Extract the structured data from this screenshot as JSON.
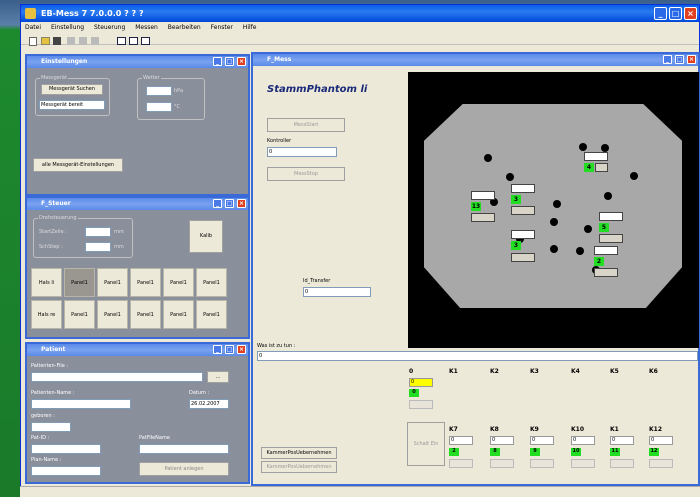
{
  "app": {
    "title": "EB-Mess 7   7.0.0.0 ? ? ?",
    "menu": [
      "Datei",
      "Einstellung",
      "Steuerung",
      "Messen",
      "Bearbeiten",
      "Fenster",
      "Hilfe"
    ]
  },
  "einstellungen": {
    "title": "Einstellungen",
    "messgeraet_group": "Messgerät",
    "suchen_btn": "Messgerät Suchen",
    "bereit_field": "Messgerät bereit",
    "wetter_group": "Wetter",
    "unit_hpa": "hPa",
    "unit_c": "°C",
    "alle_btn": "alle Messgerät-Einstellungen"
  },
  "steuer": {
    "title": "F_Steuer",
    "group": "Drehsteuerung",
    "startzeile_label": "StartZeile :",
    "startzeile_unit": "mm",
    "schritte_label": "SchStep :",
    "schritte_unit": "mm",
    "kalib_btn": "Kalib",
    "buttons_row1": [
      "Hals li",
      "Panel1",
      "Panel1",
      "Panel1",
      "Panel1",
      "Panel1"
    ],
    "buttons_row2": [
      "Hals re",
      "Panel1",
      "Panel1",
      "Panel1",
      "Panel1",
      "Panel1"
    ]
  },
  "patient": {
    "title": "Patient",
    "file_label": "Patienten-File :",
    "browse_btn": "...",
    "name_label": "Patienten-Name :",
    "datum_label": "Datum :",
    "datum_value": "26.02.2007",
    "geboren_label": "geboren :",
    "pat_id_label": "Pat-ID :",
    "patfilename_label": "PatFileName",
    "plan_label": "Plan-Name :",
    "bottom_btn": "Patient anlegen"
  },
  "mess": {
    "title": "F_Mess",
    "phantom_title": "StammPhantom li",
    "messstart_btn": "MessStart",
    "kontroller_label": "Kontroller",
    "kontroller_value": "0",
    "messstop_btn": "MessStop",
    "transfer_label": "Id_Transfer",
    "transfer_value": "0",
    "was_label": "Was ist zu tun :",
    "was_value": "0",
    "kammer_btn": "KammerPosUebernehmen",
    "kammer_btn2": "KammerPosUebernehmen",
    "schalt_btn": "Schalt Ein",
    "k_headers_top": [
      "0",
      "K1",
      "K2",
      "K3",
      "K4",
      "K5",
      "K6"
    ],
    "k0_value": "0",
    "k0_green": "0",
    "k_headers_bottom": [
      "K7",
      "K8",
      "K9",
      "K10",
      "K1",
      "K12"
    ],
    "k_bottom_values": [
      "0",
      "0",
      "0",
      "0",
      "0",
      "0"
    ],
    "k_bottom_green": [
      "2",
      "8",
      "9",
      "10",
      "11",
      "12"
    ]
  },
  "ct_markers": [
    {
      "green": "4"
    },
    {
      "green": "13"
    },
    {
      "green": "3"
    },
    {
      "green": "3"
    },
    {
      "green": "2"
    },
    {
      "green": "5"
    }
  ],
  "colors": {
    "title_blue": "#0a5ee8",
    "green": "#22dd22",
    "yellow": "#ffff00"
  }
}
